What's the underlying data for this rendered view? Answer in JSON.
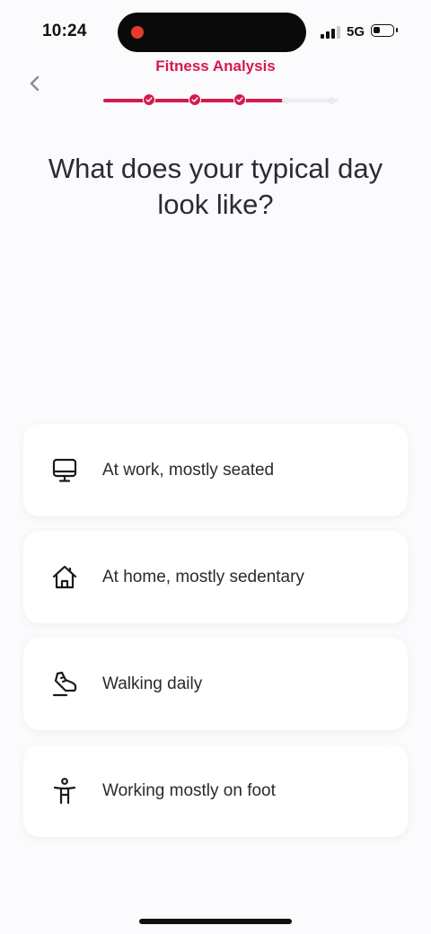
{
  "status_bar": {
    "time": "10:24",
    "network": "5G",
    "battery_level": 0.3,
    "signal_bars_active": 3
  },
  "header": {
    "title": "Fitness Analysis",
    "back_icon": "chevron-left-icon"
  },
  "progress": {
    "total_steps": 5,
    "completed_steps": 3,
    "fill_fraction": 0.77
  },
  "question": {
    "text": "What does your typical day look like?"
  },
  "options": [
    {
      "label": "At work, mostly seated",
      "icon": "monitor-icon"
    },
    {
      "label": "At home, mostly sedentary",
      "icon": "house-icon"
    },
    {
      "label": "Walking daily",
      "icon": "sneaker-icon"
    },
    {
      "label": "Working mostly on foot",
      "icon": "standing-person-icon"
    }
  ],
  "colors": {
    "accent": "#d6194e",
    "background": "#fbfafc",
    "card": "#ffffff",
    "text": "#2c2c30"
  }
}
